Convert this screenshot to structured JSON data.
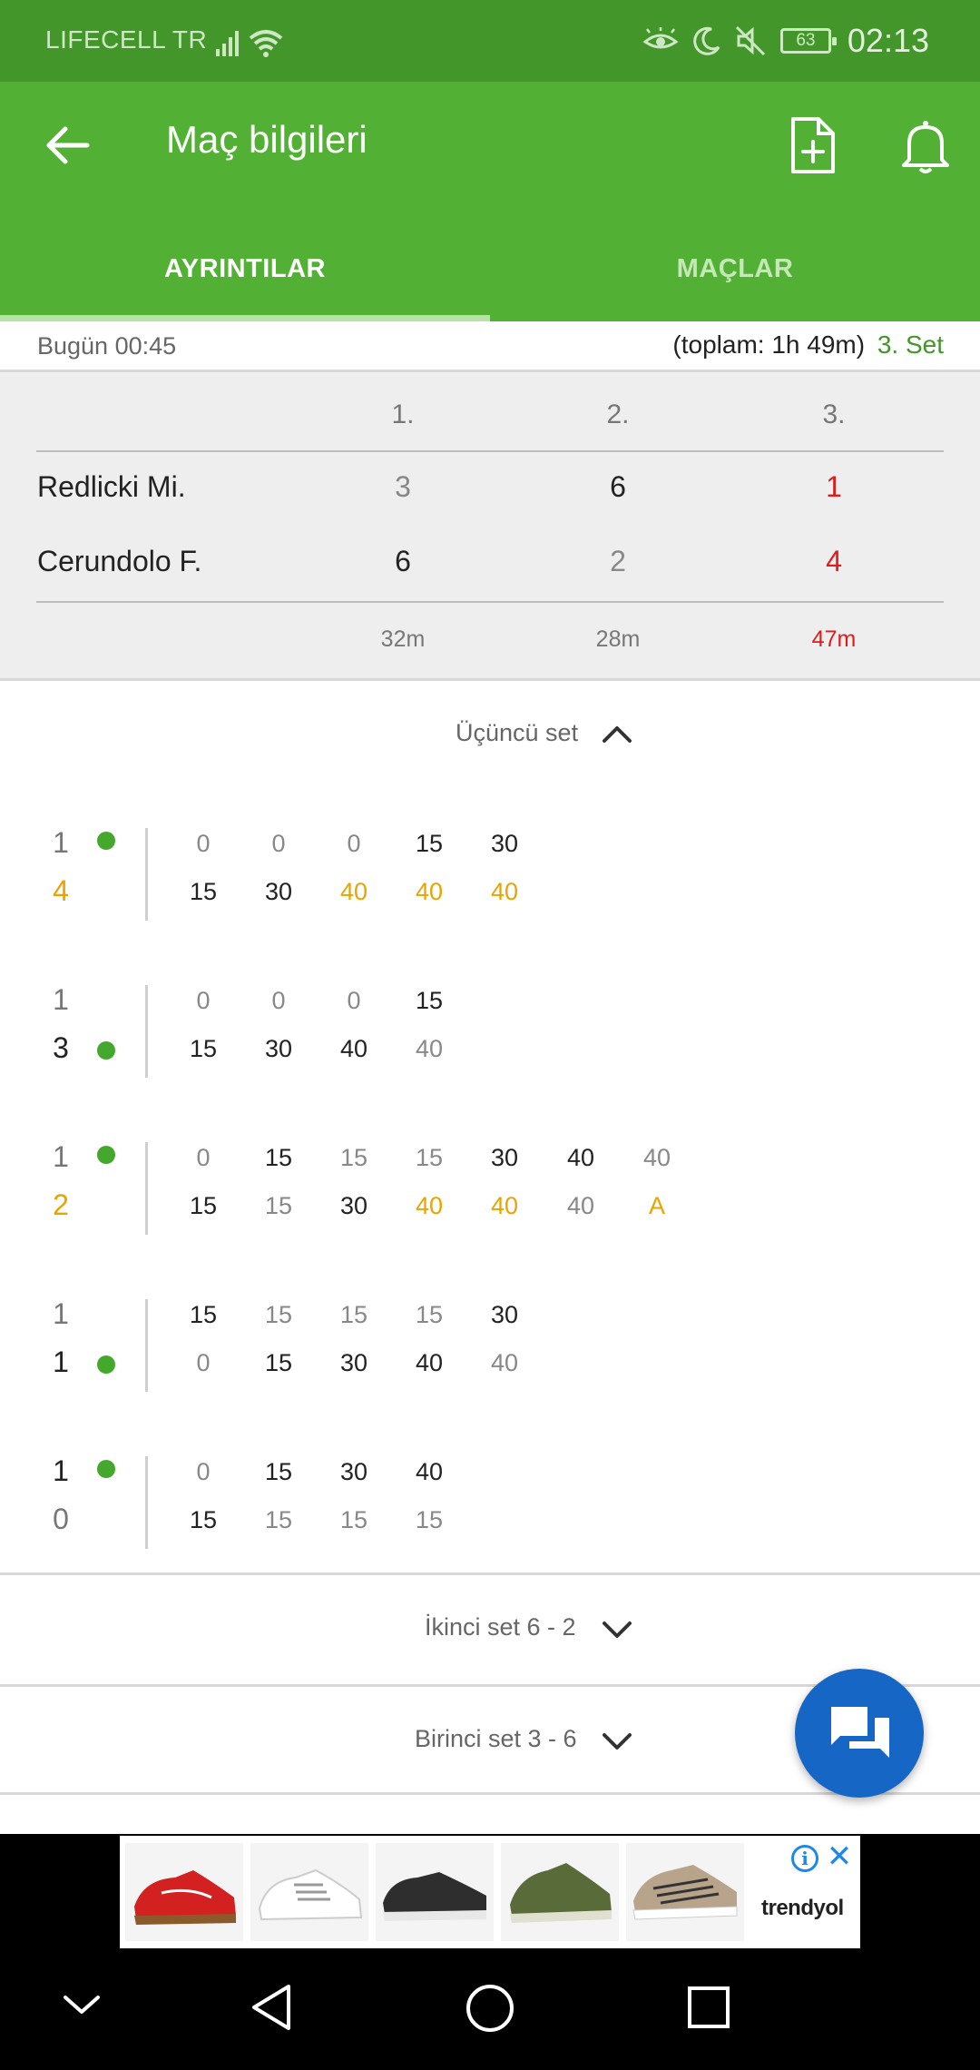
{
  "status_bar": {
    "carrier": "LIFECELL TR",
    "battery": "63",
    "time": "02:13",
    "icons": [
      "signal-icon",
      "wifi-icon",
      "eye-comfort-icon",
      "moon-icon",
      "mute-icon",
      "battery-icon"
    ]
  },
  "app_bar": {
    "title": "Maç bilgileri",
    "icons": [
      "back-arrow-icon",
      "add-document-icon",
      "bell-icon"
    ],
    "tabs": [
      {
        "label": "AYRINTILAR",
        "active": true
      },
      {
        "label": "MAÇLAR",
        "active": false
      }
    ]
  },
  "match_info": {
    "date": "Bugün 00:45",
    "total": "(toplam: 1h 49m)",
    "current_set": "3. Set"
  },
  "score_table": {
    "headers": [
      "1.",
      "2.",
      "3."
    ],
    "players": [
      {
        "name": "Redlicki Mi.",
        "scores": [
          "3",
          "6",
          "1"
        ]
      },
      {
        "name": "Cerundolo F.",
        "scores": [
          "6",
          "2",
          "4"
        ]
      }
    ],
    "durations": [
      "32m",
      "28m",
      "47m"
    ]
  },
  "third_set": {
    "label": "Üçüncü set",
    "games": [
      {
        "score_top": "1",
        "score_bottom": "4",
        "server": "top",
        "points_top": [
          "0",
          "0",
          "0",
          "15",
          "30"
        ],
        "points_bottom": [
          "15",
          "30",
          "40",
          "40",
          "40"
        ]
      },
      {
        "score_top": "1",
        "score_bottom": "3",
        "server": "bottom",
        "points_top": [
          "0",
          "0",
          "0",
          "15"
        ],
        "points_bottom": [
          "15",
          "30",
          "40",
          "40"
        ]
      },
      {
        "score_top": "1",
        "score_bottom": "2",
        "server": "top",
        "points_top": [
          "0",
          "15",
          "15",
          "15",
          "30",
          "40",
          "40"
        ],
        "points_bottom": [
          "15",
          "15",
          "30",
          "40",
          "40",
          "40",
          "A"
        ]
      },
      {
        "score_top": "1",
        "score_bottom": "1",
        "server": "bottom",
        "points_top": [
          "15",
          "15",
          "15",
          "15",
          "30"
        ],
        "points_bottom": [
          "0",
          "15",
          "30",
          "40",
          "40"
        ]
      },
      {
        "score_top": "1",
        "score_bottom": "0",
        "server": "top",
        "points_top": [
          "0",
          "15",
          "30",
          "40"
        ],
        "points_bottom": [
          "15",
          "15",
          "15",
          "15"
        ]
      }
    ]
  },
  "collapsed_sets": [
    {
      "label": "İkinci set 6 - 2"
    },
    {
      "label": "Birinci set 3 - 6"
    }
  ],
  "fab": {
    "icon": "chat-icon"
  },
  "ad": {
    "brand": "trendyol",
    "info": "i",
    "close": "✕",
    "products": 5
  },
  "nav_bar": {
    "icons": [
      "hide-nav-icon",
      "back-triangle-icon",
      "home-circle-icon",
      "recents-square-icon"
    ]
  },
  "colors": {
    "status_bar": "#43962a",
    "app_bar": "#52b135",
    "live_score": "#e01b1b",
    "game_winner_score": "#e9a400",
    "server_dot": "#43a82c",
    "fab": "#1666c6"
  }
}
